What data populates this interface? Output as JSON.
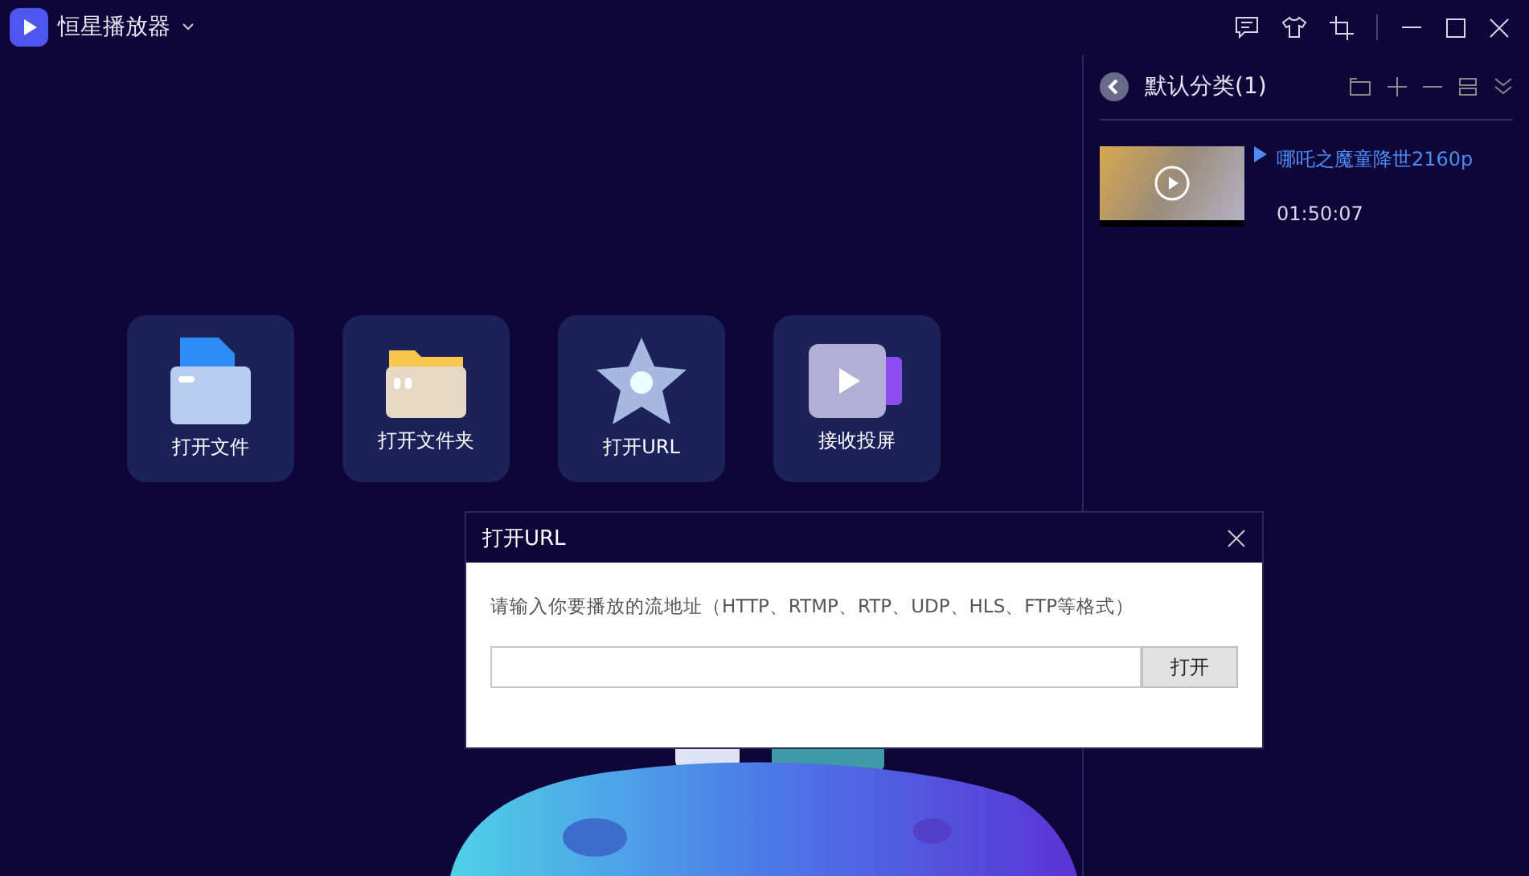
{
  "app": {
    "title": "恒星播放器"
  },
  "actions": [
    {
      "kind": "file",
      "label": "打开文件"
    },
    {
      "kind": "folder",
      "label": "打开文件夹"
    },
    {
      "kind": "url",
      "label": "打开URL"
    },
    {
      "kind": "cast",
      "label": "接收投屏"
    }
  ],
  "playlist": {
    "category": "默认分类(1)",
    "items": [
      {
        "title": "哪吒之魔童降世2160p",
        "duration": "01:50:07",
        "playing": true
      }
    ]
  },
  "dialog": {
    "title": "打开URL",
    "prompt": "请输入你要播放的流地址（HTTP、RTMP、RTP、UDP、HLS、FTP等格式）",
    "button": "打开"
  }
}
